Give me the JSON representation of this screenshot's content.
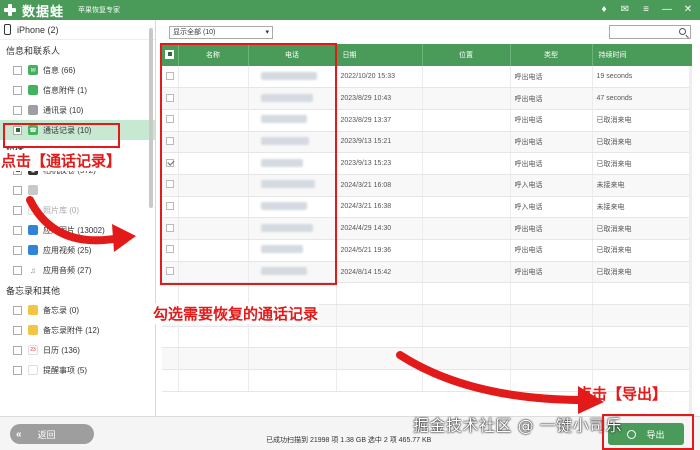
{
  "app": {
    "name": "数据蛙",
    "slogan": "苹果恢复专家",
    "controls": [
      "♦",
      "✉",
      "≡",
      "—",
      "✕"
    ]
  },
  "sidebar": {
    "device": "iPhone (2)",
    "sections": [
      {
        "title": "信息和联系人",
        "items": [
          {
            "label": "信息 (66)",
            "icon": "message-icon",
            "state": "none"
          },
          {
            "label": "信息附件 (1)",
            "icon": "attachment-icon",
            "state": "none"
          },
          {
            "label": "通讯录 (10)",
            "icon": "contacts-icon",
            "state": "none"
          },
          {
            "label": "通话记录 (10)",
            "icon": "phone-icon",
            "state": "filled",
            "active": true
          }
        ]
      },
      {
        "title": "媒体",
        "items": [
          {
            "label": "相机胶卷 (572)",
            "icon": "camera-icon",
            "state": "filled"
          },
          {
            "label": "",
            "icon": "photo-icon",
            "state": "none",
            "muted": true
          },
          {
            "label": "照片库 (0)",
            "icon": "gallery-icon",
            "state": "none",
            "muted": true
          },
          {
            "label": "应用图片 (13002)",
            "icon": "app-image-icon",
            "state": "none"
          },
          {
            "label": "应用视频 (25)",
            "icon": "app-video-icon",
            "state": "none"
          },
          {
            "label": "应用音频 (27)",
            "icon": "music-icon",
            "state": "none"
          }
        ]
      },
      {
        "title": "备忘录和其他",
        "items": [
          {
            "label": "备忘录 (0)",
            "icon": "memo-icon",
            "state": "none"
          },
          {
            "label": "备忘录附件 (12)",
            "icon": "memo-attachment-icon",
            "state": "none"
          },
          {
            "label": "日历 (136)",
            "icon": "calendar-icon",
            "state": "none"
          },
          {
            "label": "提醒事项 (5)",
            "icon": "reminder-icon",
            "state": "none"
          }
        ]
      }
    ]
  },
  "toolbar": {
    "filter": "显示全部 (10)"
  },
  "table": {
    "headers": [
      "名称",
      "电话",
      "日期",
      "位置",
      "类型",
      "持续时间"
    ],
    "rows": [
      {
        "date": "2022/10/20 15:33",
        "location": "",
        "type": "呼出电话",
        "duration": "19 seconds",
        "checked": false
      },
      {
        "date": "2023/8/29 10:43",
        "location": "",
        "type": "呼出电话",
        "duration": "47 seconds",
        "checked": false
      },
      {
        "date": "2023/8/29 13:37",
        "location": "",
        "type": "呼出电话",
        "duration": "已取消来电",
        "checked": false
      },
      {
        "date": "2023/9/13 15:21",
        "location": "",
        "type": "呼出电话",
        "duration": "已取消来电",
        "checked": false
      },
      {
        "date": "2023/9/13 15:23",
        "location": "",
        "type": "呼出电话",
        "duration": "已取消来电",
        "checked": true
      },
      {
        "date": "2024/3/21 16:08",
        "location": "",
        "type": "呼入电话",
        "duration": "未接来电",
        "checked": false
      },
      {
        "date": "2024/3/21 16:38",
        "location": "",
        "type": "呼入电话",
        "duration": "未接来电",
        "checked": false
      },
      {
        "date": "2024/4/29 14:30",
        "location": "",
        "type": "呼出电话",
        "duration": "已取消来电",
        "checked": false
      },
      {
        "date": "2024/5/21 19:36",
        "location": "",
        "type": "呼出电话",
        "duration": "已取消来电",
        "checked": false
      },
      {
        "date": "2024/8/14 15:42",
        "location": "",
        "type": "呼出电话",
        "duration": "已取消来电",
        "checked": false
      }
    ]
  },
  "footer": {
    "back_label": "返回",
    "status": "已成功扫描到 21998 项 1.38 GB  选中 2 项 465.77 KB",
    "export_label": "导出",
    "watermark": "掘金技术社区 @ 一键小司乐"
  },
  "annotations": {
    "click_call_log": "点击【通话记录】",
    "select_records": "勾选需要恢复的通话记录",
    "click_export": "点击【导出】"
  },
  "colors": {
    "brand_green": "#4a9b5a",
    "highlight_red": "#e21a1a",
    "active_row": "#c8e9d1"
  }
}
